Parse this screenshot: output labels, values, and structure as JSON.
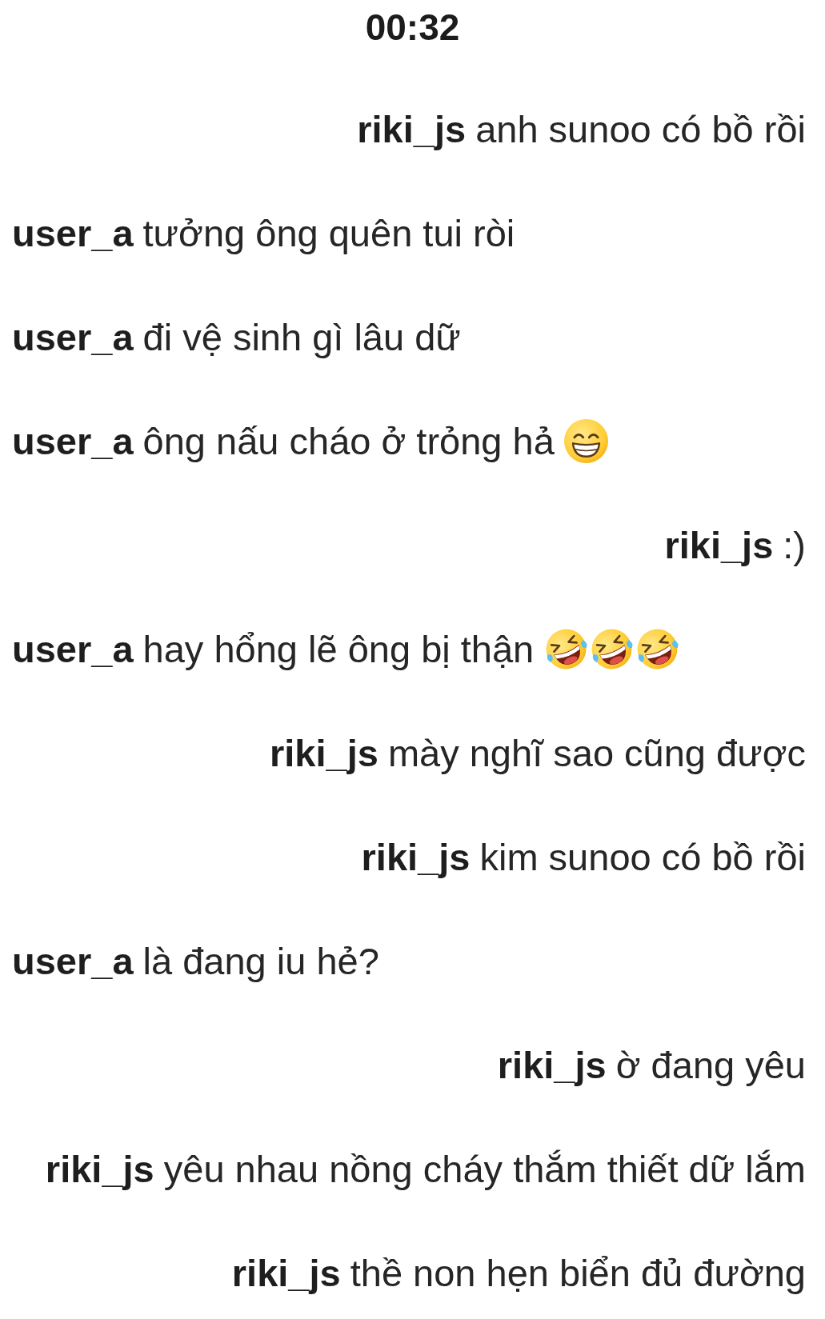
{
  "time": "00:32",
  "messages": [
    {
      "sender": "riki_js",
      "outgoing": true,
      "text": "anh sunoo có bồ rồi"
    },
    {
      "sender": "user_a",
      "outgoing": false,
      "text": "tưởng ông quên tui ròi"
    },
    {
      "sender": "user_a",
      "outgoing": false,
      "text": "đi vệ sinh gì lâu dữ"
    },
    {
      "sender": "user_a",
      "outgoing": false,
      "text": "ông nấu cháo ở trỏng hả",
      "emojis": [
        {
          "kind": "grin"
        }
      ]
    },
    {
      "sender": "riki_js",
      "outgoing": true,
      "text": ":)"
    },
    {
      "sender": "user_a",
      "outgoing": false,
      "text": "hay hổng lẽ ông bị thận",
      "emojis": [
        {
          "kind": "rofl"
        },
        {
          "kind": "rofl"
        },
        {
          "kind": "rofl"
        }
      ]
    },
    {
      "sender": "riki_js",
      "outgoing": true,
      "text": "mày nghĩ sao cũng được"
    },
    {
      "sender": "riki_js",
      "outgoing": true,
      "text": "kim sunoo có bồ rồi"
    },
    {
      "sender": "user_a",
      "outgoing": false,
      "text": "là đang iu hẻ?"
    },
    {
      "sender": "riki_js",
      "outgoing": true,
      "text": "ờ đang yêu"
    },
    {
      "sender": "riki_js",
      "outgoing": true,
      "text": "yêu nhau nồng cháy thắm thiết dữ lắm"
    },
    {
      "sender": "riki_js",
      "outgoing": true,
      "text": "thề non hẹn biển đủ đường"
    }
  ]
}
